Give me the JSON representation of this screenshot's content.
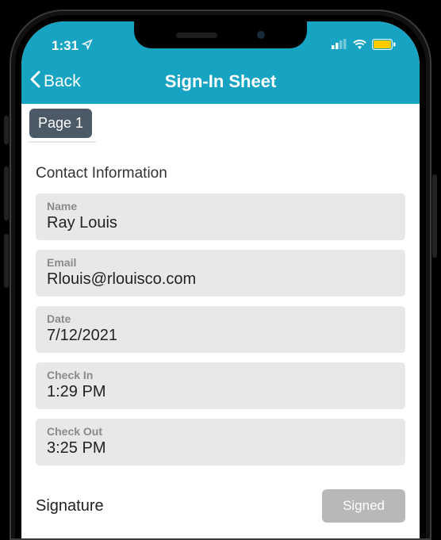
{
  "status": {
    "time": "1:31",
    "location_icon": "location-arrow"
  },
  "nav": {
    "back": "Back",
    "title": "Sign-In Sheet"
  },
  "page_tab": "Page 1",
  "section_title": "Contact Information",
  "fields": {
    "name": {
      "label": "Name",
      "value": "Ray Louis"
    },
    "email": {
      "label": "Email",
      "value": "Rlouis@rlouisco.com"
    },
    "date": {
      "label": "Date",
      "value": "7/12/2021"
    },
    "checkin": {
      "label": "Check In",
      "value": "1:29 PM"
    },
    "checkout": {
      "label": "Check Out",
      "value": "3:25 PM"
    }
  },
  "signature": {
    "label": "Signature",
    "button": "Signed"
  },
  "colors": {
    "accent": "#17a4c2",
    "field_bg": "#e8e8e8",
    "tab_bg": "#4b5a66",
    "battery": "#ffcc00"
  }
}
